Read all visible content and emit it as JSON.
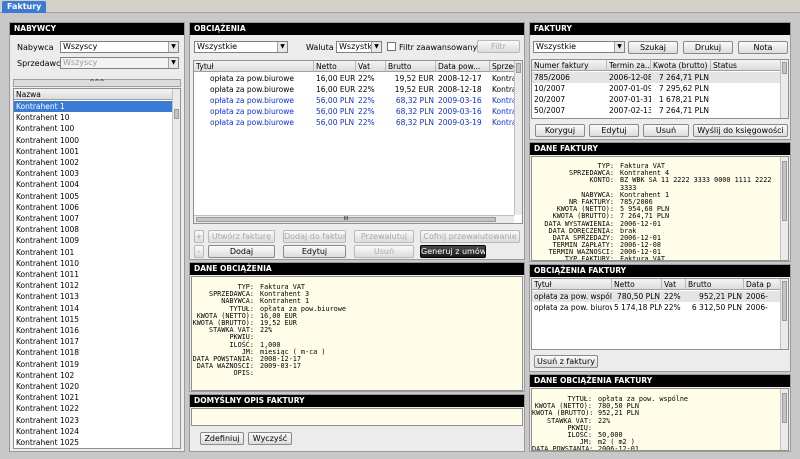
{
  "window": {
    "tab": "Faktury"
  },
  "nabywcy": {
    "title": "NABYWCY",
    "nabywca_label": "Nabywca",
    "nabywca_value": "Wszyscy",
    "sprzedawca_label": "Sprzedawca",
    "sprzedawca_value": "Wszyscy",
    "sort_arrows": "^^^",
    "column": "Nazwa",
    "items": [
      "Kontrahent 1",
      "Kontrahent 10",
      "Kontrahent 100",
      "Kontrahent 1000",
      "Kontrahent 1001",
      "Kontrahent 1002",
      "Kontrahent 1003",
      "Kontrahent 1004",
      "Kontrahent 1005",
      "Kontrahent 1006",
      "Kontrahent 1007",
      "Kontrahent 1008",
      "Kontrahent 1009",
      "Kontrahent 101",
      "Kontrahent 1010",
      "Kontrahent 1011",
      "Kontrahent 1012",
      "Kontrahent 1013",
      "Kontrahent 1014",
      "Kontrahent 1015",
      "Kontrahent 1016",
      "Kontrahent 1017",
      "Kontrahent 1018",
      "Kontrahent 1019",
      "Kontrahent 102",
      "Kontrahent 1020",
      "Kontrahent 1021",
      "Kontrahent 1022",
      "Kontrahent 1023",
      "Kontrahent 1024",
      "Kontrahent 1025"
    ]
  },
  "obciazenia": {
    "title": "OBCIĄŻENIA",
    "filter_value": "Wszystkie",
    "waluta_label": "Waluta",
    "waluta_value": "Wszystkie",
    "advanced_filter_label": "Filtr zaawansowany",
    "filter_button": "Filtr",
    "columns": [
      "Tytuł",
      "Netto",
      "Vat",
      "Brutto",
      "Data pow...",
      "Sprzedaw"
    ],
    "rows": [
      {
        "tytul": "opłata za pow.biurowe",
        "netto": "16,00 EUR",
        "vat": "22%",
        "brutto": "19,52 EUR",
        "data": "2008-12-17",
        "sprzed": "Kontrahe",
        "blue": false
      },
      {
        "tytul": "opłata za pow.biurowe",
        "netto": "16,00 EUR",
        "vat": "22%",
        "brutto": "19,52 EUR",
        "data": "2008-12-18",
        "sprzed": "Kontrahe",
        "blue": false
      },
      {
        "tytul": "opłata za pow.biurowe",
        "netto": "56,00 PLN",
        "vat": "22%",
        "brutto": "68,32 PLN",
        "data": "2009-03-16",
        "sprzed": "Kontrahe",
        "blue": true
      },
      {
        "tytul": "opłata za pow.biurowe",
        "netto": "56,00 PLN",
        "vat": "22%",
        "brutto": "68,32 PLN",
        "data": "2009-03-16",
        "sprzed": "Kontrahe",
        "blue": true
      },
      {
        "tytul": "opłata za pow.biurowe",
        "netto": "56,00 PLN",
        "vat": "22%",
        "brutto": "68,32 PLN",
        "data": "2009-03-19",
        "sprzed": "Kontrahe",
        "blue": true
      }
    ],
    "scroll_grip": "III",
    "btn_plus": "+",
    "btn_minus": "-",
    "btn_utworz": "Utwórz fakturę",
    "btn_dodaj_do": "Dodaj do faktury",
    "btn_przewalutuj": "Przewalutuj",
    "btn_cofnij": "Cofnij przewalutowanie",
    "btn_dodaj": "Dodaj",
    "btn_edytuj": "Edytuj",
    "btn_usun": "Usuń",
    "btn_generuj": "Generuj z umów"
  },
  "dane_obciazenia": {
    "title": "DANE OBCIĄŻENIA",
    "fields": [
      {
        "k": "TYP:",
        "v": "Faktura VAT"
      },
      {
        "k": "SPRZEDAWCA:",
        "v": "Kontrahent 3"
      },
      {
        "k": "NABYWCA:",
        "v": "Kontrahent 1"
      },
      {
        "k": "TYTUŁ:",
        "v": "opłata za pow.biurowe"
      },
      {
        "k": "KWOTA (NETTO):",
        "v": "16,00 EUR"
      },
      {
        "k": "KWOTA (BRUTTO):",
        "v": "19,52 EUR"
      },
      {
        "k": "STAWKA VAT:",
        "v": "22%"
      },
      {
        "k": "PKWIU:",
        "v": ""
      },
      {
        "k": "ILOŚĆ:",
        "v": "1,000"
      },
      {
        "k": "JM:",
        "v": "miesiąc ( m-ca )"
      },
      {
        "k": "DATA POWSTANIA:",
        "v": "2008-12-17"
      },
      {
        "k": "DATA WAŻNOŚCI:",
        "v": "2009-03-17"
      },
      {
        "k": "OPIS:",
        "v": ""
      }
    ]
  },
  "domyslny_opis": {
    "title": "DOMYŚLNY OPIS FAKTURY",
    "btn_zdefiniuj": "Zdefiniuj",
    "btn_wyczysc": "Wyczyść"
  },
  "faktury": {
    "title": "FAKTURY",
    "filter_value": "Wszystkie",
    "btn_szukaj": "Szukaj",
    "btn_drukuj": "Drukuj",
    "btn_nota": "Nota",
    "columns": [
      "Numer faktury",
      "Termin za...",
      "Kwota (brutto)",
      "Status"
    ],
    "rows": [
      {
        "num": "785/2006",
        "termin": "2006-12-08",
        "kwota": "7 264,71 PLN",
        "status": ""
      },
      {
        "num": "10/2007",
        "termin": "2007-01-09",
        "kwota": "7 295,62 PLN",
        "status": ""
      },
      {
        "num": "20/2007",
        "termin": "2007-01-31",
        "kwota": "1 678,21 PLN",
        "status": ""
      },
      {
        "num": "50/2007",
        "termin": "2007-02-13",
        "kwota": "7 264,71 PLN",
        "status": ""
      }
    ],
    "btn_koryguj": "Koryguj",
    "btn_edytuj": "Edytuj",
    "btn_usun": "Usuń",
    "btn_wyslij": "Wyślij do księgowości"
  },
  "dane_faktury": {
    "title": "DANE FAKTURY",
    "fields": [
      {
        "k": "TYP:",
        "v": "Faktura VAT"
      },
      {
        "k": "SPRZEDAWCA:",
        "v": "Kontrahent 4"
      },
      {
        "k": "KONTO:",
        "v": "BZ WBK SA 11 2222 3333 0000 1111 2222"
      },
      {
        "k": "",
        "v": "3333"
      },
      {
        "k": "NABYWCA:",
        "v": "Kontrahent 1"
      },
      {
        "k": "NR FAKTURY:",
        "v": "785/2006"
      },
      {
        "k": "KWOTA (NETTO):",
        "v": "5 954,68 PLN"
      },
      {
        "k": "KWOTA (BRUTTO):",
        "v": "7 264,71 PLN"
      },
      {
        "k": "DATA WYSTAWIENIA:",
        "v": "2006-12-01"
      },
      {
        "k": "DATA DORĘCZENIA:",
        "v": "brak"
      },
      {
        "k": "DATA SPRZEDAŻY:",
        "v": "2006-12-01"
      },
      {
        "k": "TERMIN ZAPŁATY:",
        "v": "2006-12-08"
      },
      {
        "k": "TERMIN WAŻNOŚCI:",
        "v": "2006-12-01"
      },
      {
        "k": "TYP FAKTURY:",
        "v": "Faktura VAT"
      }
    ]
  },
  "obciazenia_faktury": {
    "title": "OBCIĄŻENIA FAKTURY",
    "columns": [
      "Tytuł",
      "Netto",
      "Vat",
      "Brutto",
      "Data p"
    ],
    "rows": [
      {
        "tytul": "opłata za pow. wspólne",
        "netto": "780,50 PLN",
        "vat": "22%",
        "brutto": "952,21 PLN",
        "data": "2006-"
      },
      {
        "tytul": "opłata za pow. biurowe",
        "netto": "5 174,18 PLN",
        "vat": "22%",
        "brutto": "6 312,50 PLN",
        "data": "2006-"
      }
    ],
    "btn_usun": "Usuń z faktury"
  },
  "dane_obciazenia_faktury": {
    "title": "DANE OBCIĄŻENIA FAKTURY",
    "fields": [
      {
        "k": "TYTUŁ:",
        "v": "opłata za pow. wspólne"
      },
      {
        "k": "KWOTA (NETTO):",
        "v": "780,50 PLN"
      },
      {
        "k": "KWOTA (BRUTTO):",
        "v": "952,21 PLN"
      },
      {
        "k": "STAWKA VAT:",
        "v": "22%"
      },
      {
        "k": "PKWIU:",
        "v": ""
      },
      {
        "k": "ILOŚĆ:",
        "v": "50,000"
      },
      {
        "k": "JM:",
        "v": "m2 ( m2 )"
      },
      {
        "k": "DATA POWSTANIA:",
        "v": "2006-12-01"
      }
    ]
  },
  "colors": {
    "header_bg": "#000000",
    "selection": "#3a7bd5",
    "detail_bg": "#fffde8",
    "link_blue": "#1030e0"
  }
}
